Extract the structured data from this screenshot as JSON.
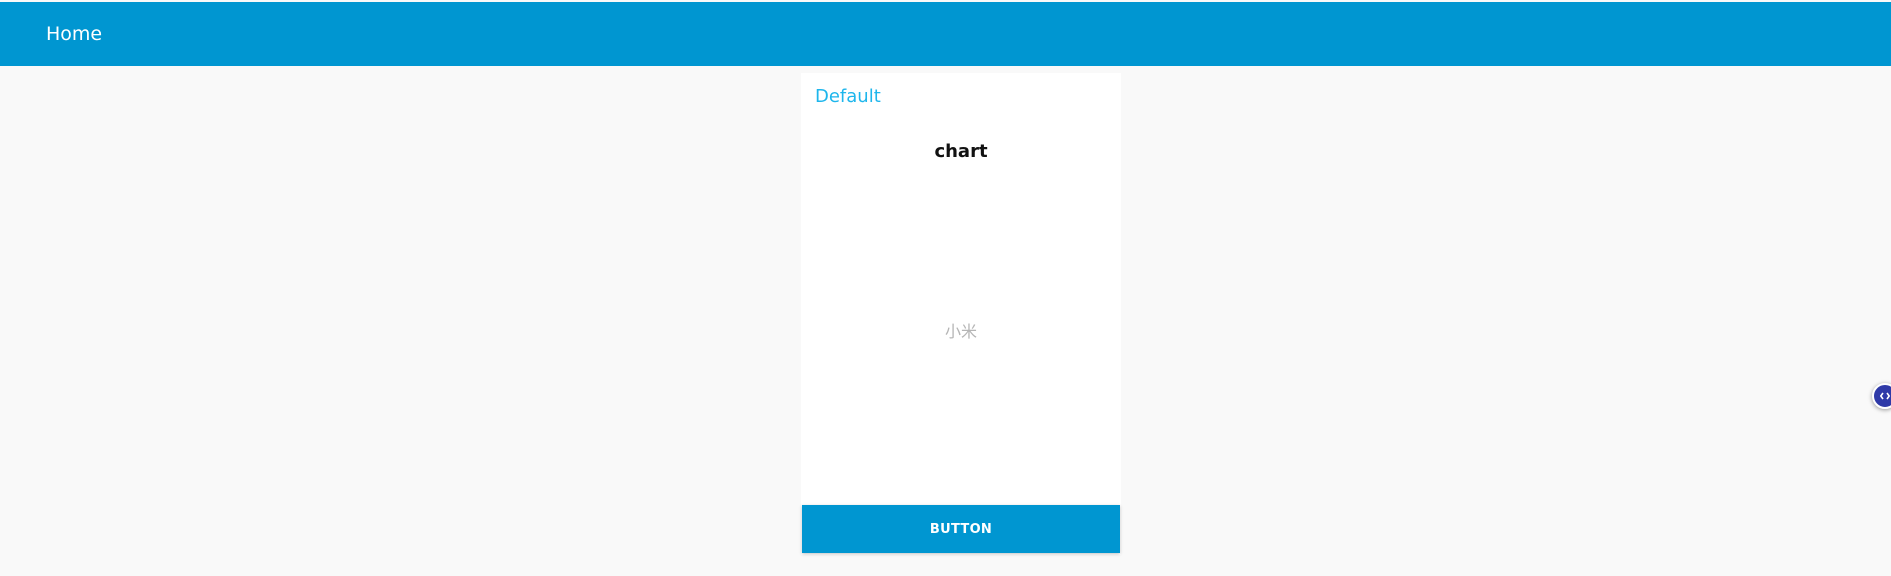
{
  "header": {
    "title": "Home"
  },
  "card": {
    "title": "Default",
    "chart": {
      "title": "chart",
      "label": "小米"
    },
    "button_label": "BUTTON"
  },
  "floating_widget": {
    "icon": "code-icon"
  },
  "colors": {
    "primary": "#0096d1",
    "accent": "#1eb6ec",
    "background": "#f9f9f9",
    "widget": "#2f3aa8"
  }
}
